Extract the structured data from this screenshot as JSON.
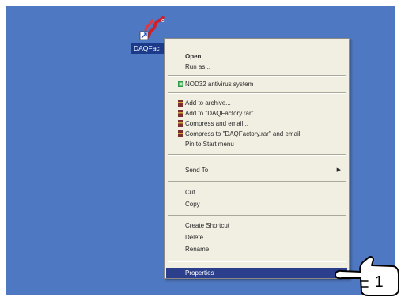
{
  "desktop": {
    "background_color": "#4f78c2",
    "shortcut": {
      "label": "DAQFac",
      "icon": "daqfactory-shortcut-icon"
    }
  },
  "context_menu": {
    "selected_color": "#2c3f8c",
    "items": {
      "open": "Open",
      "run_as": "Run as...",
      "nod32": "NOD32 antivirus system",
      "add_archive": "Add to archive...",
      "add_rar": "Add to \"DAQFactory.rar\"",
      "compress_email": "Compress and email...",
      "compress_rar_email": "Compress to \"DAQFactory.rar\" and email",
      "pin_start": "Pin to Start menu",
      "send_to": "Send To",
      "cut": "Cut",
      "copy": "Copy",
      "create_shortcut": "Create Shortcut",
      "delete": "Delete",
      "rename": "Rename",
      "properties": "Properties"
    }
  },
  "callout": {
    "number": "1"
  }
}
